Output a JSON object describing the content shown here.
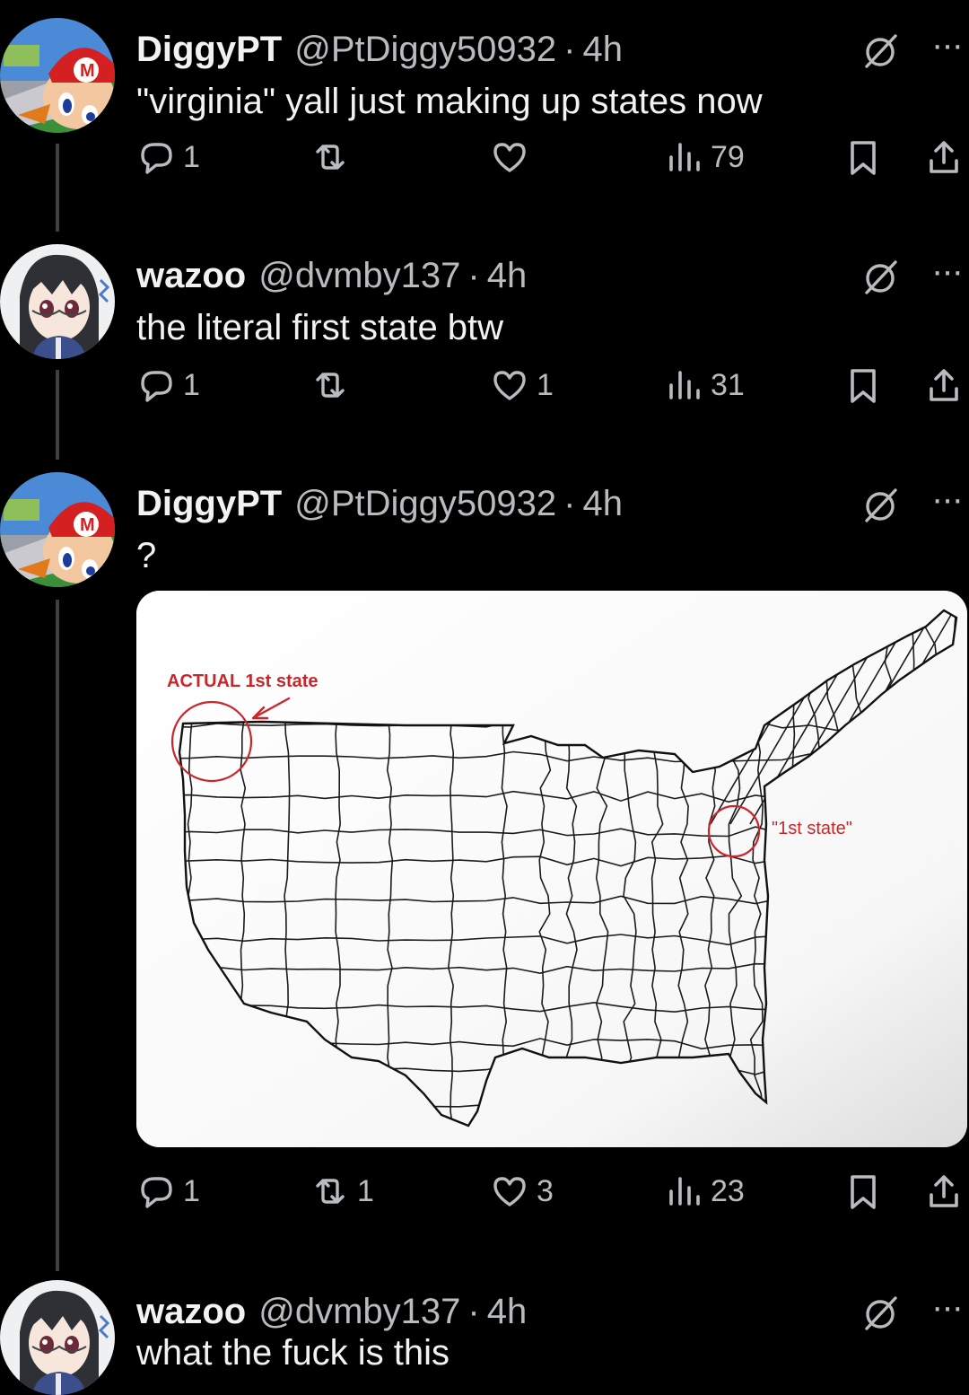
{
  "tweets": [
    {
      "name": "DiggyPT",
      "handle": "@PtDiggy50932",
      "separator": "·",
      "time": "4h",
      "text": "\"virginia\" yall just making up states now",
      "avatar": "mario-avatar",
      "stats": {
        "replies": "1",
        "retweets": "",
        "likes": "",
        "views": "79"
      }
    },
    {
      "name": "wazoo",
      "handle": "@dvmby137",
      "separator": "·",
      "time": "4h",
      "text": "the literal first state btw",
      "avatar": "anime-girl-avatar",
      "stats": {
        "replies": "1",
        "retweets": "",
        "likes": "1",
        "views": "31"
      }
    },
    {
      "name": "DiggyPT",
      "handle": "@PtDiggy50932",
      "separator": "·",
      "time": "4h",
      "text": "?",
      "avatar": "mario-avatar",
      "stats": {
        "replies": "1",
        "retweets": "1",
        "likes": "3",
        "views": "23"
      },
      "media": {
        "type": "annotated-us-county-map",
        "annotation_west": "ACTUAL 1st state",
        "annotation_east": "\"1st state\"",
        "annotation_color": "#c9262b"
      }
    },
    {
      "name": "wazoo",
      "handle": "@dvmby137",
      "separator": "·",
      "time": "4h",
      "text": "what the fuck is this",
      "avatar": "anime-girl-avatar"
    }
  ],
  "icons": {
    "reply": "reply-icon",
    "retweet": "retweet-icon",
    "like": "heart-icon",
    "views": "views-icon",
    "bookmark": "bookmark-icon",
    "share": "share-icon",
    "grok": "grok-icon",
    "more": "more-icon"
  },
  "more_glyph": "···",
  "colors": {
    "background": "#000000",
    "text": "#e7e9ea",
    "muted": "#b9bcbf",
    "thread_line": "#3e4144"
  }
}
